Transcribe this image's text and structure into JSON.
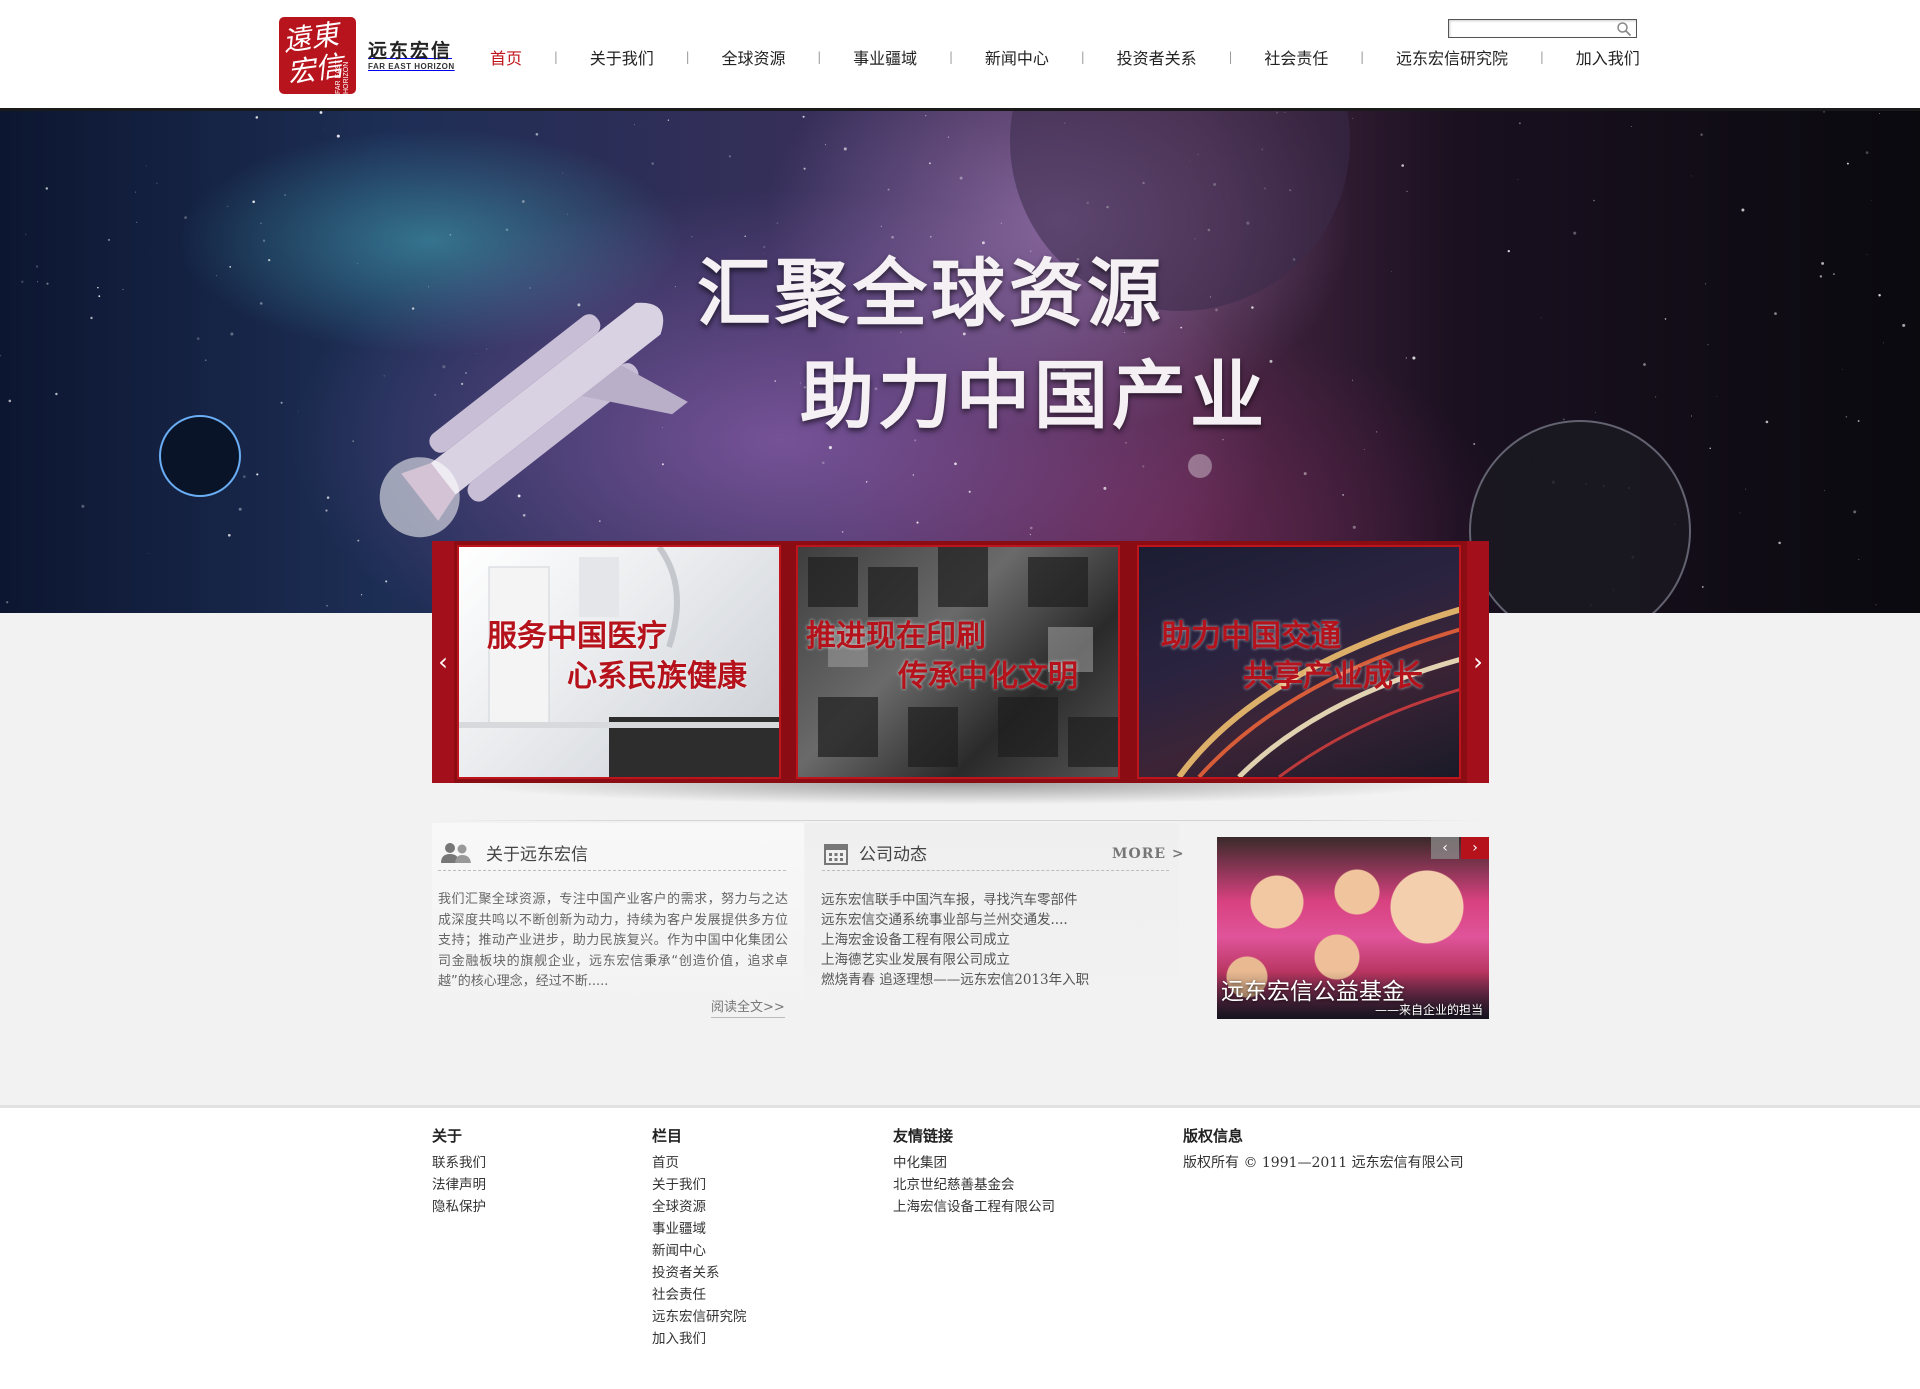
{
  "brand": {
    "calligraphy": "遠東宏信",
    "name_cn": "远东宏信",
    "name_en": "FAR EAST HORIZON",
    "seal_en": "FAR EAST HORIZON",
    "color": "#b8141e"
  },
  "search": {
    "value": "",
    "placeholder": "",
    "icon": "search-icon"
  },
  "nav": {
    "items": [
      {
        "label": "首页",
        "active": true
      },
      {
        "label": "关于我们"
      },
      {
        "label": "全球资源"
      },
      {
        "label": "事业疆域"
      },
      {
        "label": "新闻中心"
      },
      {
        "label": "投资者关系"
      },
      {
        "label": "社会责任"
      },
      {
        "label": "远东宏信研究院"
      },
      {
        "label": "加入我们"
      }
    ],
    "separator": "|",
    "active_color": "#c0141c"
  },
  "banner": {
    "slogan_line1": "汇聚全球资源",
    "slogan_line2": "助力中国产业"
  },
  "carousel": {
    "prev_icon": "chevron-left-icon",
    "next_icon": "chevron-right-icon",
    "prev_glyph": "‹",
    "next_glyph": "›",
    "slides": [
      {
        "line1": "服务中国医疗",
        "line2": "心系民族健康"
      },
      {
        "line1": "推进现在印刷",
        "line2": "传承中化文明"
      },
      {
        "line1": "助力中国交通",
        "line2": "共享产业成长"
      }
    ],
    "accent": "#8c0c14"
  },
  "about": {
    "title": "关于远东宏信",
    "icon": "people-icon",
    "text": "我们汇聚全球资源，专注中国产业客户的需求，努力与之达成深度共鸣以不断创新为动力，持续为客户发展提供多方位支持；推动产业进步，助力民族复兴。作为中国中化集团公司金融板块的旗舰企业，远东宏信秉承“创造价值，追求卓越”的核心理念，经过不断.....",
    "read_more": "阅读全文>>"
  },
  "news": {
    "title": "公司动态",
    "icon": "calendar-icon",
    "more": "MORE >",
    "items": [
      "远东宏信联手中国汽车报，寻找汽车零部件",
      "远东宏信交通系统事业部与兰州交通发....",
      "上海宏金设备工程有限公司成立",
      "上海德艺实业发展有限公司成立",
      "燃烧青春 追逐理想——远东宏信2013年入职"
    ]
  },
  "charity": {
    "title": "远东宏信公益基金",
    "subtitle": "——来自企业的担当",
    "prev_glyph": "‹",
    "next_glyph": "›"
  },
  "footer": {
    "col1": {
      "title": "关于",
      "links": [
        "联系我们",
        "法律声明",
        "隐私保护"
      ]
    },
    "col2": {
      "title": "栏目",
      "links": [
        "首页",
        "关于我们",
        "全球资源",
        "事业疆域",
        "新闻中心",
        "投资者关系",
        "社会责任",
        "远东宏信研究院",
        "加入我们"
      ]
    },
    "col3": {
      "title": "友情链接",
      "links": [
        "中化集团",
        "北京世纪慈善基金会",
        "上海宏信设备工程有限公司"
      ]
    },
    "col4": {
      "title": "版权信息",
      "text": "版权所有 © 1991—2011 远东宏信有限公司"
    }
  }
}
